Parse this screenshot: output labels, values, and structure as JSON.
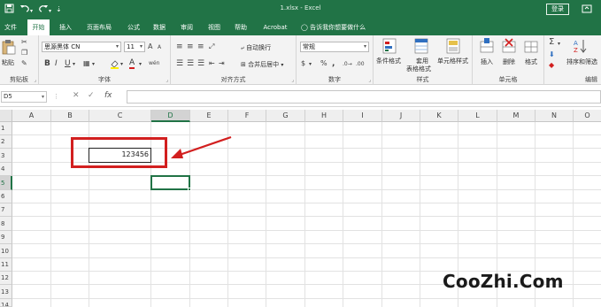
{
  "titlebar": {
    "title": "1.xlsx  -  Excel",
    "login": "登录",
    "save_icon": "save-icon",
    "undo_icon": "undo-icon",
    "redo_icon": "redo-icon",
    "customize_icon": "customize-qat-icon",
    "bg_color": "#217346"
  },
  "tabs": [
    {
      "label": "文件"
    },
    {
      "label": "开始",
      "active": true
    },
    {
      "label": "插入"
    },
    {
      "label": "页面布局"
    },
    {
      "label": "公式"
    },
    {
      "label": "数据"
    },
    {
      "label": "审阅"
    },
    {
      "label": "视图"
    },
    {
      "label": "帮助"
    },
    {
      "label": "Acrobat"
    }
  ],
  "tell_me": "告诉我你想要做什么",
  "ribbon": {
    "clipboard": {
      "paste": "粘贴",
      "label": "剪贴板"
    },
    "font": {
      "font_name": "思源黑体 CN",
      "font_size": "11",
      "bold": "B",
      "italic": "I",
      "underline": "U",
      "grow": "A",
      "shrink": "A",
      "font_color": "A",
      "wen": "wén",
      "label": "字体"
    },
    "alignment": {
      "wrap": "自动换行",
      "merge": "合并后居中",
      "label": "对齐方式"
    },
    "number": {
      "format": "常规",
      "percent": "%",
      "comma": ",",
      "label": "数字"
    },
    "styles": {
      "conditional": "条件格式",
      "table_format_1": "套用",
      "table_format_2": "表格格式",
      "cell_styles": "单元格样式",
      "label": "样式"
    },
    "cells": {
      "insert": "插入",
      "delete": "删除",
      "format": "格式",
      "label": "单元格"
    },
    "editing": {
      "sort_filter": "排序和筛选",
      "label": "编辑"
    }
  },
  "formula_bar": {
    "name_box": "D5",
    "fx": "fx",
    "cancel": "✕",
    "enter": "✓",
    "value": ""
  },
  "grid": {
    "columns": [
      "A",
      "B",
      "C",
      "D",
      "E",
      "F",
      "G",
      "H",
      "I",
      "J",
      "K",
      "L",
      "M",
      "N",
      "O"
    ],
    "selected_column": "D",
    "rows": [
      "1",
      "2",
      "3",
      "4",
      "5",
      "6",
      "7",
      "8",
      "9",
      "10",
      "11",
      "12",
      "13",
      "14"
    ],
    "selected_row": "5",
    "cells": [
      {
        "ref": "C3",
        "value": "123456"
      }
    ],
    "active_cell": "D5",
    "accent": "#217346",
    "highlight_color": "#d21f1f"
  },
  "watermark": "CooZhi.Com"
}
